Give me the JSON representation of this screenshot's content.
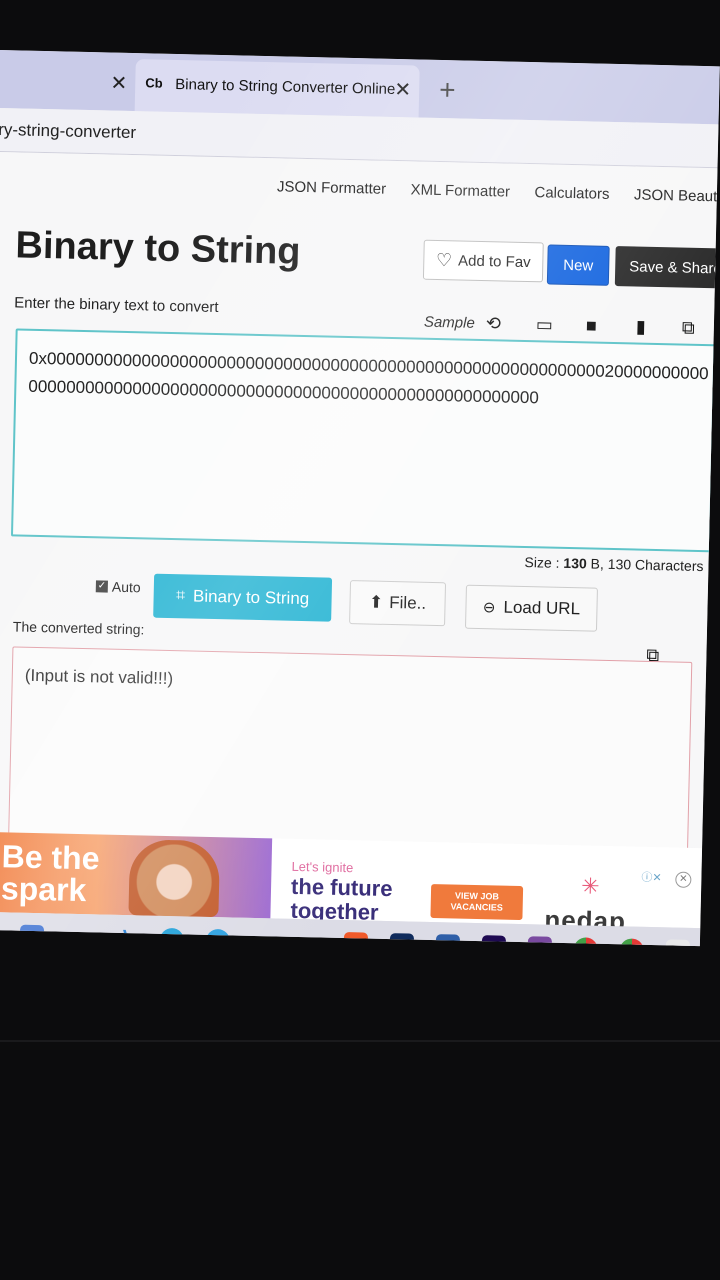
{
  "browser": {
    "prev_tab_close": "✕",
    "tab_favicon": "Cb",
    "tab_title": "Binary to String Converter Online",
    "tab_close": "✕",
    "new_tab": "+",
    "address": "ry-string-converter"
  },
  "nav": [
    "JSON Formatter",
    "XML Formatter",
    "Calculators",
    "JSON Beautifier"
  ],
  "page": {
    "title": "Binary to String",
    "add_fav": "Add to Fav",
    "new_label": "New",
    "save_share": "Save & Share",
    "input_label": "Enter the binary text to convert",
    "sample_label": "Sample",
    "input_value": "0x0000000000000000000000000000000000000000000000000000000000020000000000000000000000000000000000000000000000000000000000000000",
    "size_prefix": "Size : ",
    "size_value": "130",
    "size_suffix": " B, 130 Characters",
    "auto_label": "Auto",
    "convert_label": "Binary to String",
    "file_label": "File..",
    "load_url_label": "Load URL",
    "output_label": "The converted string:",
    "output_value": "(Input is not valid!!!)"
  },
  "ad": {
    "headline": "Be the spark",
    "tagline_small": "Let's ignite",
    "tagline_big": "the future together",
    "cta": "VIEW JOB VACANCIES",
    "brand": "nedap"
  },
  "taskbar": {
    "icons": [
      "store-icon",
      "vlc-icon",
      "vscode-icon",
      "edge-icon",
      "telegram-icon",
      "capcut-icon",
      "feather-icon",
      "brave-icon",
      "photoshop-icon",
      "maps-icon",
      "premiere-icon",
      "winrar-icon",
      "chrome-icon",
      "chrome-profile-icon",
      "notepad-icon"
    ]
  },
  "colors": {
    "convert_button": "#26b4d3",
    "new_button": "#1565e0",
    "input_border": "#5fc4c9",
    "output_border": "#e2a0a8"
  }
}
